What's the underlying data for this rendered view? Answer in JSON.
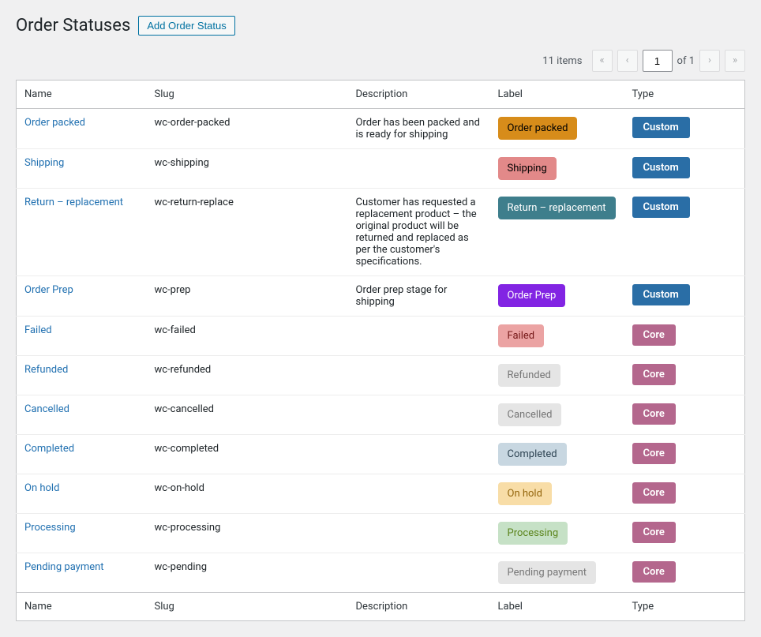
{
  "header": {
    "title": "Order Statuses",
    "add_button": "Add Order Status"
  },
  "pagination": {
    "items_text": "11 items",
    "first": "«",
    "prev": "‹",
    "page_input": "1",
    "total_text": "of 1",
    "next": "›",
    "last": "»"
  },
  "columns": {
    "name": "Name",
    "slug": "Slug",
    "description": "Description",
    "label": "Label",
    "type": "Type"
  },
  "types": {
    "custom": "Custom",
    "core": "Core"
  },
  "rows": [
    {
      "name": "Order packed",
      "slug": "wc-order-packed",
      "description": "Order has been packed and is ready for shipping",
      "label": "Order packed",
      "label_bg": "#d78c1a",
      "label_fg": "#000000",
      "type": "custom"
    },
    {
      "name": "Shipping",
      "slug": "wc-shipping",
      "description": "",
      "label": "Shipping",
      "label_bg": "#e28989",
      "label_fg": "#000000",
      "type": "custom"
    },
    {
      "name": "Return – replacement",
      "slug": "wc-return-replace",
      "description": "Customer has requested a replacement product – the original product will be returned and replaced as per the customer's specifications.",
      "label": "Return – replacement",
      "label_bg": "#3e7e8c",
      "label_fg": "#ffffff",
      "type": "custom"
    },
    {
      "name": "Order Prep",
      "slug": "wc-prep",
      "description": "Order prep stage for shipping",
      "label": "Order Prep",
      "label_bg": "#8224e3",
      "label_fg": "#ffffff",
      "type": "custom"
    },
    {
      "name": "Failed",
      "slug": "wc-failed",
      "description": "",
      "label": "Failed",
      "label_bg": "#eba3a3",
      "label_fg": "#761919",
      "type": "core"
    },
    {
      "name": "Refunded",
      "slug": "wc-refunded",
      "description": "",
      "label": "Refunded",
      "label_bg": "#e5e5e5",
      "label_fg": "#777777",
      "type": "core"
    },
    {
      "name": "Cancelled",
      "slug": "wc-cancelled",
      "description": "",
      "label": "Cancelled",
      "label_bg": "#e5e5e5",
      "label_fg": "#777777",
      "type": "core"
    },
    {
      "name": "Completed",
      "slug": "wc-completed",
      "description": "",
      "label": "Completed",
      "label_bg": "#c8d7e1",
      "label_fg": "#2e4453",
      "type": "core"
    },
    {
      "name": "On hold",
      "slug": "wc-on-hold",
      "description": "",
      "label": "On hold",
      "label_bg": "#f8dda7",
      "label_fg": "#94660c",
      "type": "core"
    },
    {
      "name": "Processing",
      "slug": "wc-processing",
      "description": "",
      "label": "Processing",
      "label_bg": "#c6e1c6",
      "label_fg": "#5b841b",
      "type": "core"
    },
    {
      "name": "Pending payment",
      "slug": "wc-pending",
      "description": "",
      "label": "Pending payment",
      "label_bg": "#e5e5e5",
      "label_fg": "#777777",
      "type": "core"
    }
  ]
}
